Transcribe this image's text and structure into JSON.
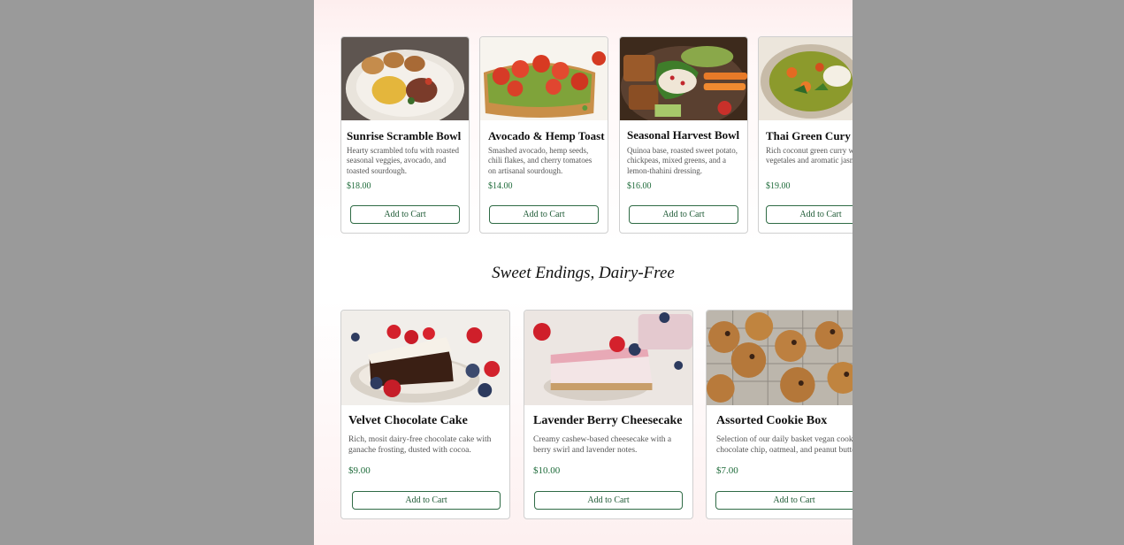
{
  "savory_items": [
    {
      "title": "Sunrise Scramble Bowl",
      "description": "Hearty scrambled tofu with roasted seasonal veggies, avocado, and toasted sourdough.",
      "price": "$18.00",
      "button": "Add to Cart"
    },
    {
      "title": "Avocado & Hemp Toast",
      "description": "Smashed avocado, hemp seeds, chili flakes, and cherry tomatoes on artisanal sourdough.",
      "price": "$14.00",
      "button": "Add to Cart"
    },
    {
      "title": "Seasonal Harvest Bowl",
      "description": "Quinoa base, roasted sweet potato, chickpeas, mixed greens, and a lemon-thahini dressing.",
      "price": "$16.00",
      "button": "Add to Cart"
    },
    {
      "title": "Thai Green Cury",
      "description": "Rich coconut green curry with vegetales and aromatic jasmi",
      "price": "$19.00",
      "button": "Add to Cart"
    }
  ],
  "dessert_section": {
    "heading": "Sweet Endings, Dairy-Free"
  },
  "dessert_items": [
    {
      "title": "Velvet Chocolate Cake",
      "description": "Rich, mosit dairy-free chocolate cake with ganache frosting, dusted with cocoa.",
      "price": "$9.00",
      "button": "Add to Cart"
    },
    {
      "title": "Lavender Berry Cheesecake",
      "description": "Creamy cashew-based cheesecake with a berry swirl and lavender notes.",
      "price": "$10.00",
      "button": "Add to Cart"
    },
    {
      "title": "Assorted Cookie Box",
      "description": "Selection of our daily basket vegan cooki chocolate chip, oatmeal, and peanut butte",
      "price": "$7.00",
      "button": "Add to Cart"
    }
  ],
  "colors": {
    "price_green": "#1e6b3a",
    "button_border": "#2f6b45",
    "backdrop_gray": "#9a9a9a"
  }
}
